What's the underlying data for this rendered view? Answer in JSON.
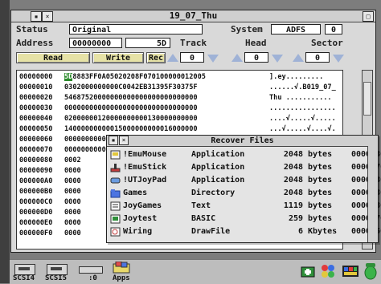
{
  "main_window": {
    "title": "19_07_Thu",
    "status_label": "Status",
    "status_value": "Original",
    "system_label": "System",
    "system_value": "ADFS",
    "system_num": "0",
    "address_label": "Address",
    "address_value": "00000000",
    "offset_value": "5D",
    "track_label": "Track",
    "head_label": "Head",
    "sector_label": "Sector",
    "read_label": "Read",
    "write_label": "Write",
    "rec_label": "Rec",
    "track_value": "0",
    "head_value": "0",
    "sector_value": "0"
  },
  "dump": {
    "rows": [
      {
        "addr": "00000000",
        "hl": "5D",
        "hex": "8883FF0A05020208F070100000012005",
        "ascii": "].ey........."
      },
      {
        "addr": "00000010",
        "hl": "",
        "hex": "0302000000000C0042EB31395F30375F",
        "ascii": "......√.B019_07_"
      },
      {
        "addr": "00000020",
        "hl": "",
        "hex": "54687520000000000000000000000000",
        "ascii": "Thu ..........."
      },
      {
        "addr": "00000030",
        "hl": "",
        "hex": "00000000000000000000000000000000",
        "ascii": "................"
      },
      {
        "addr": "00000040",
        "hl": "",
        "hex": "02000000120000000000130000000000",
        "ascii": "....√.....√....."
      },
      {
        "addr": "00000050",
        "hl": "",
        "hex": "14000000000015000000000016000000",
        "ascii": "...√.....√....√."
      },
      {
        "addr": "00000060",
        "hl": "",
        "hex": "0000000000000000",
        "ascii": ""
      },
      {
        "addr": "00000070",
        "hl": "",
        "hex": "0000000000000000",
        "ascii": ""
      },
      {
        "addr": "00000080",
        "hl": "",
        "hex": "0002",
        "ascii": ""
      },
      {
        "addr": "00000090",
        "hl": "",
        "hex": "0000",
        "ascii": ""
      },
      {
        "addr": "000000A0",
        "hl": "",
        "hex": "0000",
        "ascii": ""
      },
      {
        "addr": "000000B0",
        "hl": "",
        "hex": "0000",
        "ascii": ""
      },
      {
        "addr": "000000C0",
        "hl": "",
        "hex": "0000",
        "ascii": ""
      },
      {
        "addr": "000000D0",
        "hl": "",
        "hex": "0000",
        "ascii": ""
      },
      {
        "addr": "000000E0",
        "hl": "",
        "hex": "0000",
        "ascii": ""
      },
      {
        "addr": "000000F0",
        "hl": "",
        "hex": "0000",
        "ascii": ""
      }
    ]
  },
  "recover_window": {
    "title": "Recover Files",
    "files": [
      {
        "name": "!EmuMouse",
        "type": "Application",
        "size": "2048",
        "unit": "bytes",
        "addr": "00000300",
        "icon": "app-icon"
      },
      {
        "name": "!EmuStick",
        "type": "Application",
        "size": "2048",
        "unit": "bytes",
        "addr": "00000701",
        "icon": "joystick-icon"
      },
      {
        "name": "!UTJoyPad",
        "type": "Application",
        "size": "2048",
        "unit": "bytes",
        "addr": "00002300",
        "icon": "joypad-icon"
      },
      {
        "name": "Games",
        "type": "Directory",
        "size": "2048",
        "unit": "bytes",
        "addr": "00000300",
        "icon": "folder-icon"
      },
      {
        "name": "JoyGames",
        "type": "Text",
        "size": "1119",
        "unit": "bytes",
        "addr": "00002800",
        "icon": "text-file-icon"
      },
      {
        "name": "Joytest",
        "type": "BASIC",
        "size": "259",
        "unit": "bytes",
        "addr": "00001701",
        "icon": "basic-file-icon"
      },
      {
        "name": "Wiring",
        "type": "DrawFile",
        "size": "6",
        "unit": "Kbytes",
        "addr": "00000500",
        "icon": "drawfile-icon"
      }
    ]
  },
  "iconbar": {
    "items": [
      {
        "label": "SCSI4",
        "icon": "scsi-disk-icon"
      },
      {
        "label": "SCSI5",
        "icon": "scsi-disk-icon"
      },
      {
        "label": ":0",
        "icon": "floppy-drive-icon"
      },
      {
        "label": "Apps",
        "icon": "apps-icon"
      }
    ]
  },
  "colors": {
    "highlight": "#2a8a2a",
    "button": "#e6e2a6",
    "arrow": "#9fb2d6"
  }
}
